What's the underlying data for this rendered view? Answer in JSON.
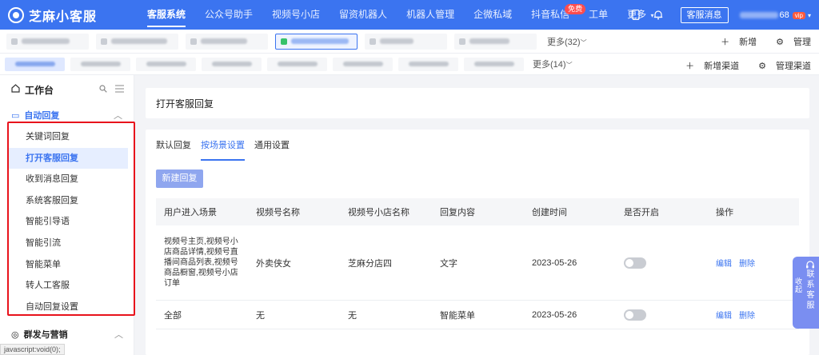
{
  "brand": {
    "name": "芝麻小客服"
  },
  "nav": {
    "items": [
      {
        "label": "客服系统",
        "active": true
      },
      {
        "label": "公众号助手"
      },
      {
        "label": "视频号小店"
      },
      {
        "label": "留资机器人"
      },
      {
        "label": "机器人管理"
      },
      {
        "label": "企微私域"
      },
      {
        "label": "抖音私信",
        "badge": "免费"
      },
      {
        "label": "工单"
      },
      {
        "label": "更多"
      }
    ],
    "kf_button": "客服消息",
    "phone_tail": "68",
    "vip": "vip"
  },
  "accounts": {
    "more": "更多(32)",
    "add": "新增",
    "manage": "管理"
  },
  "channels": {
    "more": "更多(14)",
    "add": "新增渠道",
    "manage": "管理渠道"
  },
  "sidebar": {
    "title": "工作台",
    "group1": "自动回复",
    "items": [
      "关键词回复",
      "打开客服回复",
      "收到消息回复",
      "系统客服回复",
      "智能引导语",
      "智能引流",
      "智能菜单",
      "转人工客服",
      "自动回复设置"
    ],
    "group2": "群发与营销",
    "status_text": "javascript:void(0);"
  },
  "main": {
    "page_title": "打开客服回复",
    "tabs": [
      "默认回复",
      "按场景设置",
      "通用设置"
    ],
    "new_button": "新建回复",
    "columns": [
      "用户进入场景",
      "视频号名称",
      "视频号小店名称",
      "回复内容",
      "创建时间",
      "是否开启",
      "操作"
    ],
    "rows": [
      {
        "scene": "视频号主页,视频号小店商品详情,视频号直播间商品列表,视频号商品橱窗,视频号小店订单",
        "channel": "外卖侠女",
        "shop": "芝麻分店四",
        "content": "文字",
        "created": "2023-05-26",
        "enabled": false,
        "edit": "编辑",
        "delete": "删除"
      },
      {
        "scene": "全部",
        "channel": "无",
        "shop": "无",
        "content": "智能菜单",
        "created": "2023-05-26",
        "enabled": false,
        "edit": "编辑",
        "delete": "删除"
      }
    ]
  },
  "float": {
    "fold": "收起",
    "contact": "联系客服"
  },
  "colors": {
    "primary": "#3b74f0",
    "highlight_box": "#e8121c",
    "button": "#8fa6ef"
  }
}
